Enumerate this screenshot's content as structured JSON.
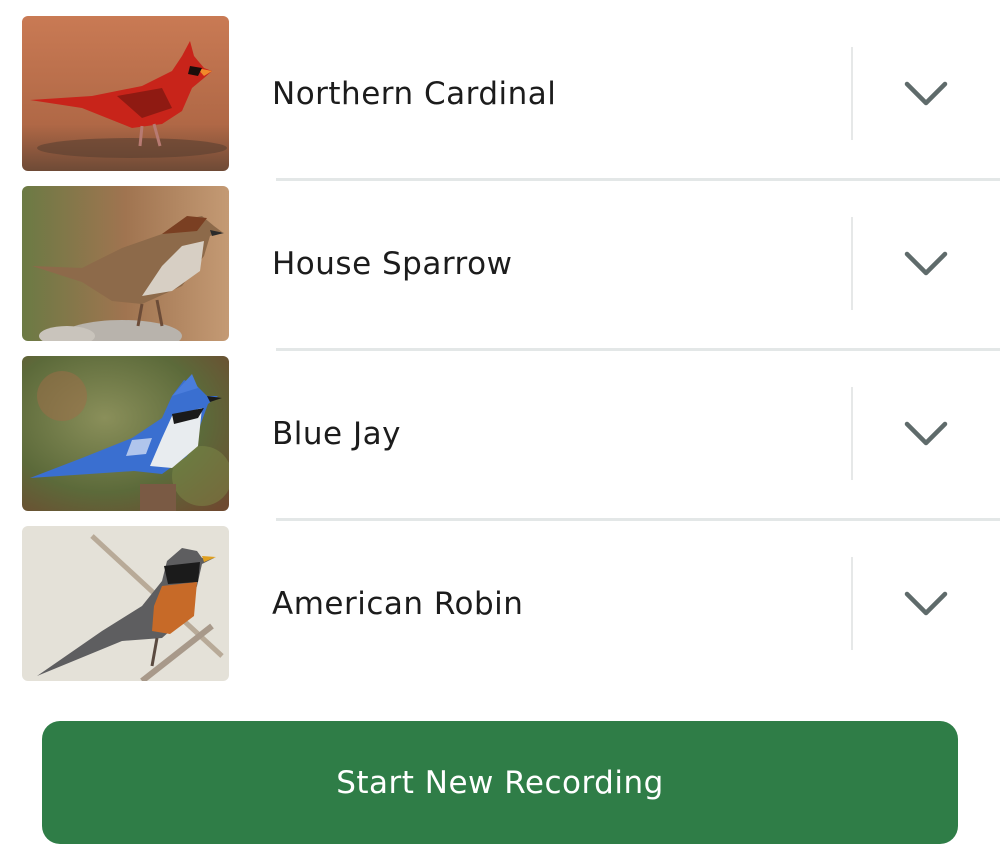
{
  "birds": [
    {
      "name": "Northern Cardinal",
      "photo_icon": "northern-cardinal-photo",
      "expand_icon": "chevron-down-icon"
    },
    {
      "name": "House Sparrow",
      "photo_icon": "house-sparrow-photo",
      "expand_icon": "chevron-down-icon"
    },
    {
      "name": "Blue Jay",
      "photo_icon": "blue-jay-photo",
      "expand_icon": "chevron-down-icon"
    },
    {
      "name": "American Robin",
      "photo_icon": "american-robin-photo",
      "expand_icon": "chevron-down-icon"
    }
  ],
  "actions": {
    "start_recording_label": "Start New Recording"
  },
  "colors": {
    "primary_button": "#2f7d47",
    "chevron": "#5f6b6b",
    "divider": "#e3e7e7",
    "text": "#1c1c1c"
  }
}
